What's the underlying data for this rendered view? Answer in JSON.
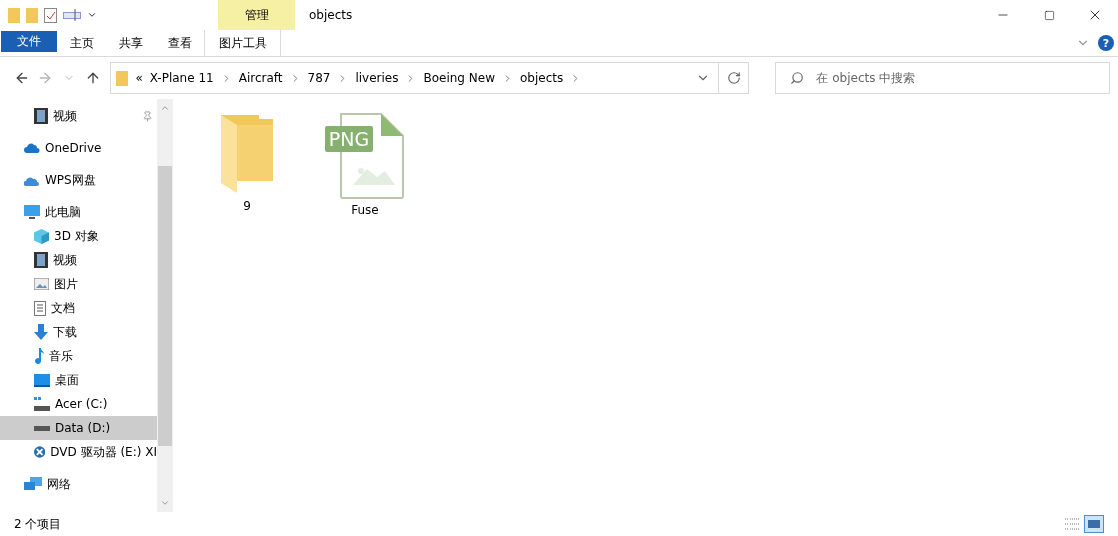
{
  "window": {
    "title": "objects"
  },
  "ribbon": {
    "context_group": "管理",
    "help": "?",
    "tabs": [
      {
        "label": "文件",
        "kind": "file",
        "selected": false
      },
      {
        "label": "主页",
        "kind": "tab",
        "selected": false
      },
      {
        "label": "共享",
        "kind": "tab",
        "selected": false
      },
      {
        "label": "查看",
        "kind": "tab",
        "selected": false
      },
      {
        "label": "图片工具",
        "kind": "context",
        "selected": false
      }
    ]
  },
  "address": {
    "overflow": "«",
    "crumbs": [
      "X-Plane 11",
      "Aircraft",
      "787",
      "liveries",
      "Boeing New",
      "objects"
    ]
  },
  "search": {
    "placeholder": "在 objects 中搜索"
  },
  "sidebar": {
    "items": [
      {
        "label": "视频",
        "kind": "video",
        "pinned": true,
        "selected": false
      },
      {
        "label": "OneDrive",
        "kind": "cloud",
        "pinned": false,
        "selected": false
      },
      {
        "label": "WPS网盘",
        "kind": "wps",
        "pinned": false,
        "selected": false
      },
      {
        "label": "此电脑",
        "kind": "pc",
        "pinned": false,
        "selected": false,
        "children": [
          {
            "label": "3D 对象",
            "kind": "cube",
            "selected": false
          },
          {
            "label": "视频",
            "kind": "video",
            "selected": false
          },
          {
            "label": "图片",
            "kind": "pictures",
            "selected": false
          },
          {
            "label": "文档",
            "kind": "docs",
            "selected": false
          },
          {
            "label": "下载",
            "kind": "download",
            "selected": false
          },
          {
            "label": "音乐",
            "kind": "music",
            "selected": false
          },
          {
            "label": "桌面",
            "kind": "desktop",
            "selected": false
          },
          {
            "label": "Acer (C:)",
            "kind": "sysdrive",
            "selected": false
          },
          {
            "label": "Data (D:)",
            "kind": "drive",
            "selected": true
          },
          {
            "label": "DVD 驱动器 (E:) XI",
            "kind": "dvd",
            "selected": false
          }
        ]
      },
      {
        "label": "网络",
        "kind": "network",
        "pinned": false,
        "selected": false
      }
    ]
  },
  "files": [
    {
      "name": "9",
      "kind": "folder"
    },
    {
      "name": "Fuse",
      "kind": "png",
      "badge": "PNG"
    }
  ],
  "status_bar": {
    "count": "2 个项目"
  }
}
